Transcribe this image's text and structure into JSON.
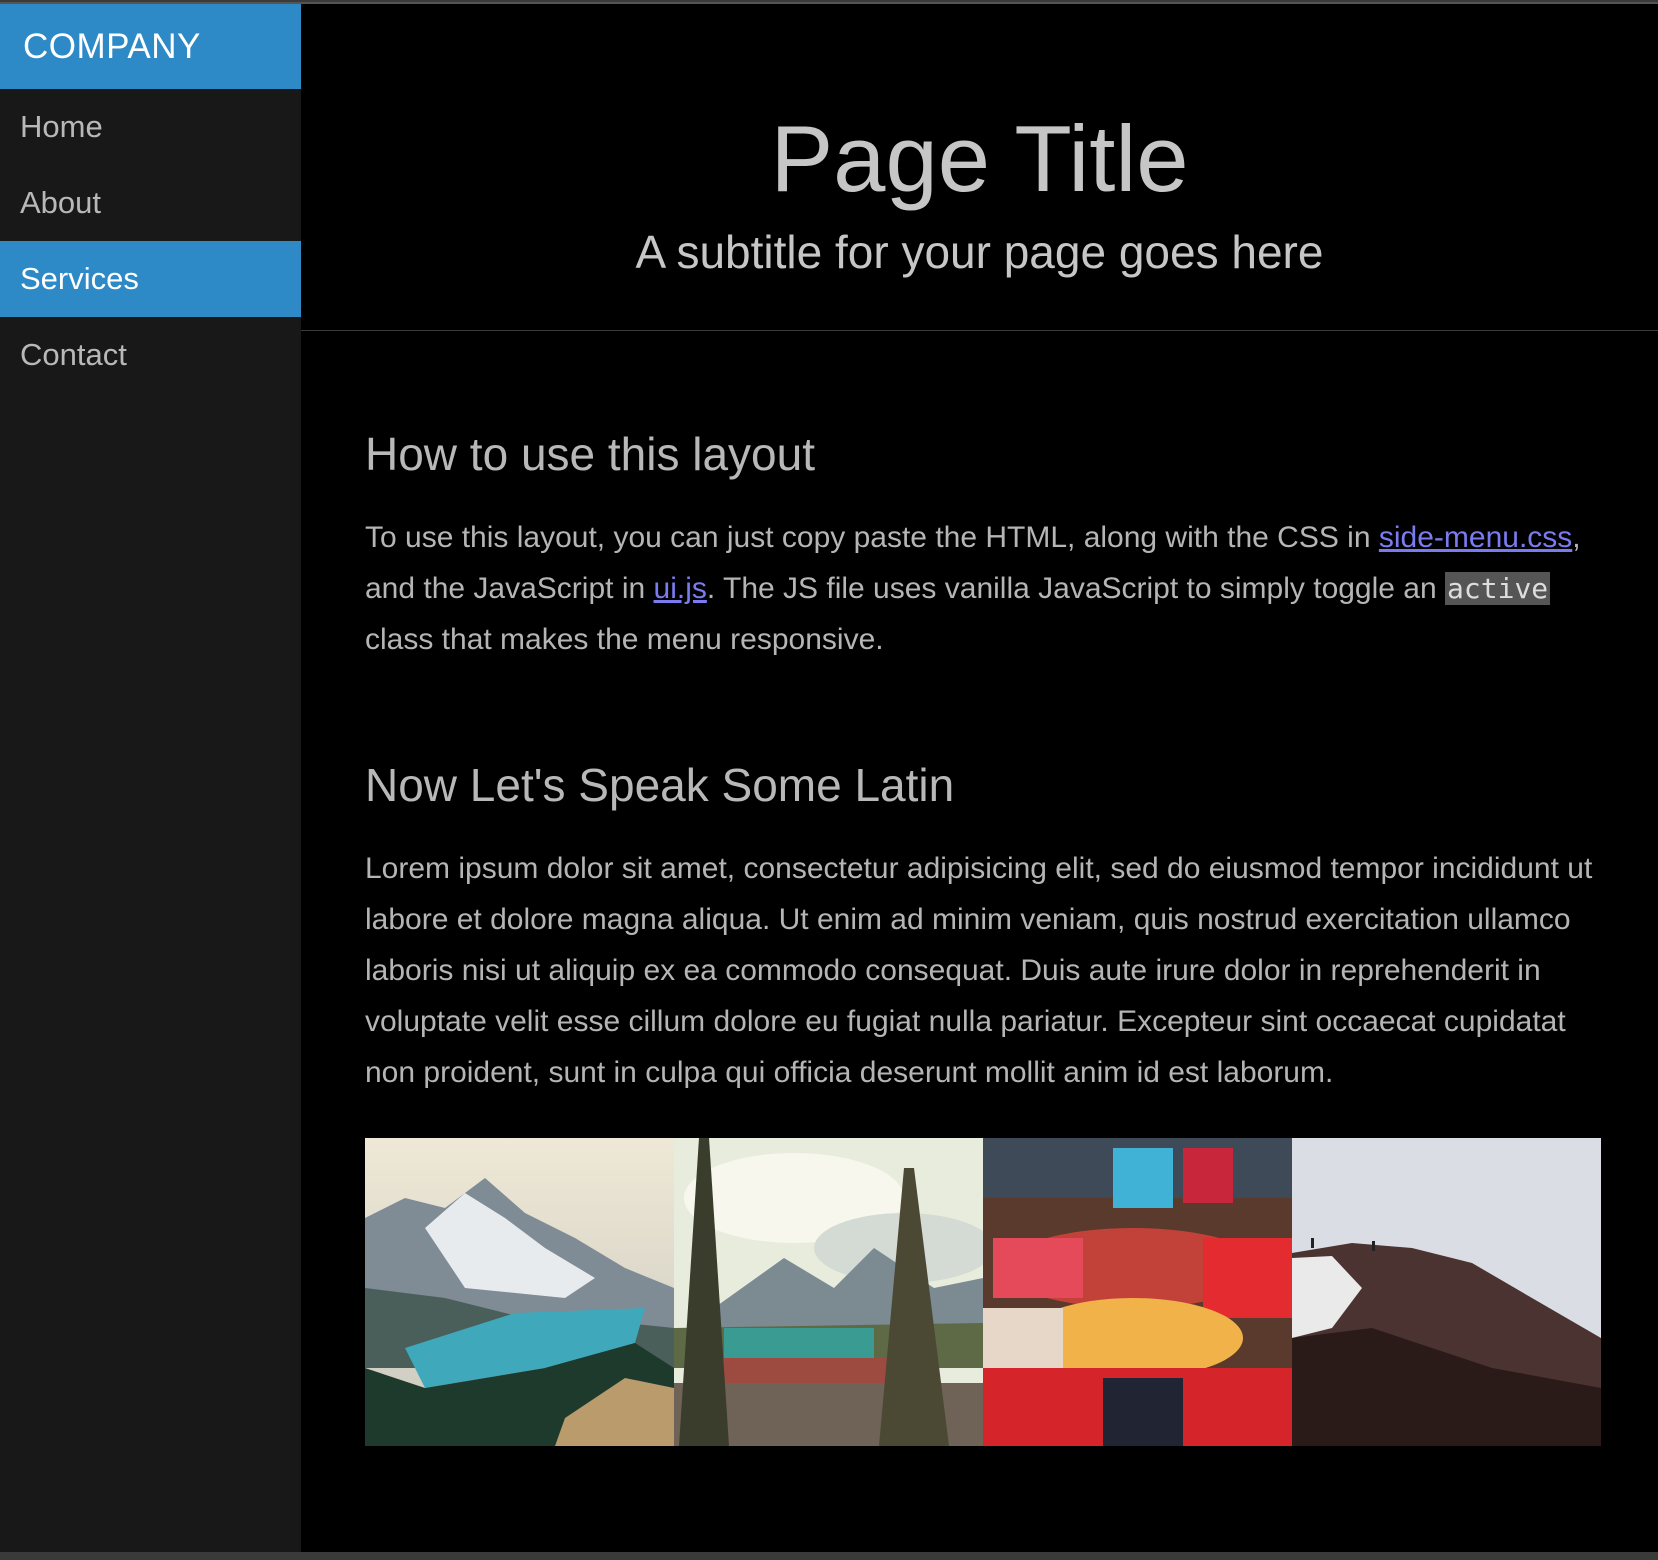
{
  "sidebar": {
    "brand": "COMPANY",
    "items": [
      {
        "label": "Home",
        "active": false
      },
      {
        "label": "About",
        "active": false
      },
      {
        "label": "Services",
        "active": true
      },
      {
        "label": "Contact",
        "active": false
      }
    ]
  },
  "header": {
    "title": "Page Title",
    "subtitle": "A subtitle for your page goes here"
  },
  "section1": {
    "heading": "How to use this layout",
    "text_1": "To use this layout, you can just copy paste the HTML, along with the CSS in ",
    "link_1": "side-menu.css",
    "text_2": ", and the JavaScript in ",
    "link_2": "ui.js",
    "text_3": ". The JS file uses vanilla JavaScript to simply toggle an ",
    "code": "active",
    "text_4": " class that makes the menu responsive."
  },
  "section2": {
    "heading": "Now Let's Speak Some Latin",
    "paragraph": "Lorem ipsum dolor sit amet, consectetur adipisicing elit, sed do eiusmod tempor incididunt ut labore et dolore magna aliqua. Ut enim ad minim veniam, quis nostrud exercitation ullamco laboris nisi ut aliquip ex ea commodo consequat. Duis aute irure dolor in reprehenderit in voluptate velit esse cillum dolore eu fugiat nulla pariatur. Excepteur sint occaecat cupidatat non proident, sunt in culpa qui officia deserunt mollit anim id est laborum."
  },
  "colors": {
    "accent": "#2d8ac6",
    "sidebar_bg": "#191818",
    "main_bg": "#000000",
    "link": "#7b7bf0"
  }
}
